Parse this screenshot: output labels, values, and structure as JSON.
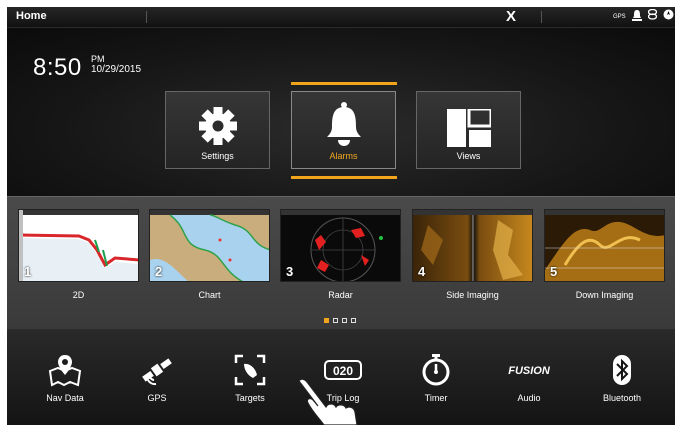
{
  "topbar": {
    "title": "Home",
    "close_label": "X",
    "status": {
      "gps_label": "GPS"
    }
  },
  "clock": {
    "time": "8:50",
    "ampm": "PM",
    "date": "10/29/2015"
  },
  "main_buttons": [
    {
      "label": "Settings"
    },
    {
      "label": "Alarms",
      "active": true
    },
    {
      "label": "Views"
    }
  ],
  "views": [
    {
      "num": "1",
      "label": "2D"
    },
    {
      "num": "2",
      "label": "Chart"
    },
    {
      "num": "3",
      "label": "Radar"
    },
    {
      "num": "4",
      "label": "Side Imaging"
    },
    {
      "num": "5",
      "label": "Down Imaging"
    }
  ],
  "page_dots": {
    "count": 4,
    "active_index": 0
  },
  "bottom_items": [
    {
      "label": "Nav Data"
    },
    {
      "label": "GPS"
    },
    {
      "label": "Targets"
    },
    {
      "label": "Trip Log",
      "counter": "020"
    },
    {
      "label": "Timer"
    },
    {
      "label": "Audio",
      "logo": "FUSION"
    },
    {
      "label": "Bluetooth"
    }
  ],
  "colors": {
    "accent": "#f2a51c",
    "background": "#050505",
    "carousel": "#444444"
  }
}
